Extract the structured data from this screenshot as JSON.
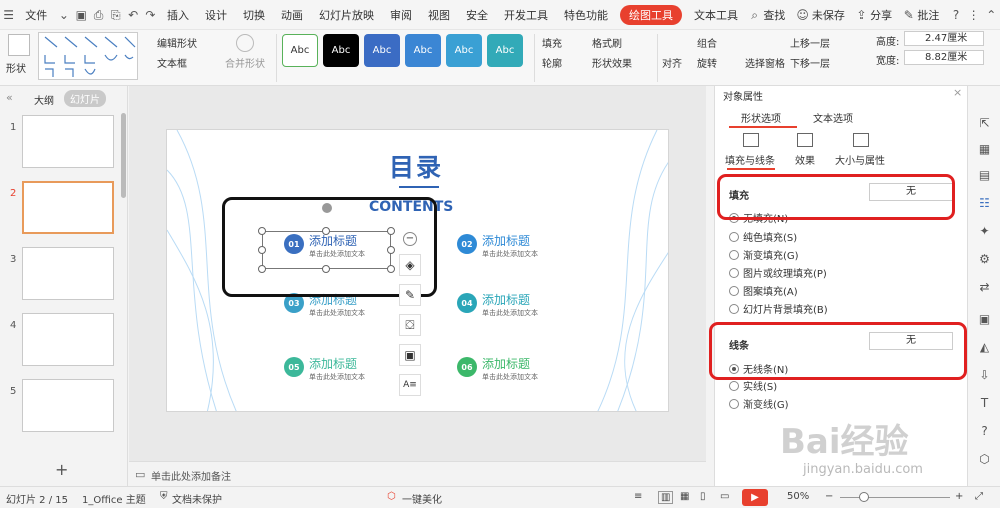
{
  "menu": {
    "file": "文件",
    "tabs": [
      "插入",
      "设计",
      "切换",
      "动画",
      "幻灯片放映",
      "审阅",
      "视图",
      "安全",
      "开发工具",
      "特色功能"
    ],
    "active_tab": "绘图工具",
    "text_tool": "文本工具",
    "search": "查找",
    "unsaved": "未保存",
    "share": "分享",
    "comment": "批注"
  },
  "ribbon": {
    "shape": "形状",
    "edit_shape": "编辑形状",
    "textbox": "文本框",
    "merge_shape": "合并形状",
    "style_sample": "Abc",
    "fill": "填充",
    "format_painter": "格式刷",
    "outline": "轮廓",
    "shape_effect": "形状效果",
    "align": "对齐",
    "group": "组合",
    "rotate": "旋转",
    "selection_pane": "选择窗格",
    "bring_forward": "上移一层",
    "send_backward": "下移一层",
    "height_label": "高度:",
    "height_value": "2.47厘米",
    "width_label": "宽度:",
    "width_value": "8.82厘米"
  },
  "left_panel": {
    "tab_outline": "大纲",
    "tab_slides": "幻灯片",
    "slide_numbers": [
      "1",
      "2",
      "3",
      "4",
      "5"
    ],
    "add": "+"
  },
  "slide": {
    "title": "目录",
    "subtitle": "CONTENTS",
    "items": [
      {
        "num": "01",
        "title": "添加标题",
        "sub": "单击此处添加文本",
        "color": "#3a6fc0"
      },
      {
        "num": "02",
        "title": "添加标题",
        "sub": "单击此处添加文本",
        "color": "#2e8ad6"
      },
      {
        "num": "03",
        "title": "添加标题",
        "sub": "单击此处添加文本",
        "color": "#3aa0c8"
      },
      {
        "num": "04",
        "title": "添加标题",
        "sub": "单击此处添加文本",
        "color": "#2aa6b8"
      },
      {
        "num": "05",
        "title": "添加标题",
        "sub": "单击此处添加文本",
        "color": "#3cb89a"
      },
      {
        "num": "06",
        "title": "添加标题",
        "sub": "单击此处添加文本",
        "color": "#3cb86a"
      }
    ]
  },
  "notes": {
    "placeholder": "单击此处添加备注"
  },
  "pane": {
    "title": "对象属性",
    "tab_shape": "形状选项",
    "tab_text": "文本选项",
    "sub_fill_line": "填充与线条",
    "sub_effect": "效果",
    "sub_size": "大小与属性",
    "fill_heading": "填充",
    "fill_value": "无",
    "fill_options": [
      "无填充(N)",
      "纯色填充(S)",
      "渐变填充(G)",
      "图片或纹理填充(P)",
      "图案填充(A)",
      "幻灯片背景填充(B)"
    ],
    "line_heading": "线条",
    "line_value": "无",
    "line_options": [
      "无线条(N)",
      "实线(S)",
      "渐变线(G)"
    ]
  },
  "status": {
    "slide": "幻灯片 2 / 15",
    "theme": "1_Office 主题",
    "protect": "文档未保护",
    "beautify": "一键美化",
    "zoom": "50%"
  },
  "watermark": {
    "brand": "Bai经验",
    "url": "jingyan.baidu.com"
  },
  "colors": {
    "accent": "#e8402e",
    "title_blue": "#2f63b4",
    "red_outline": "#e02020"
  }
}
